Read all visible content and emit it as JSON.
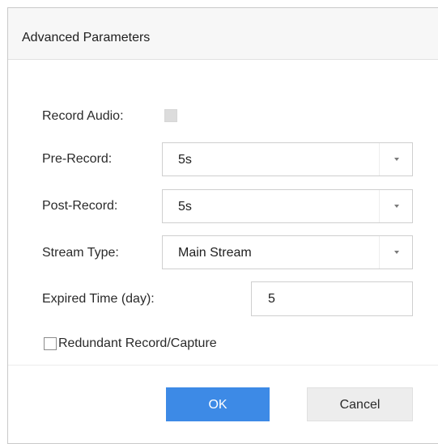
{
  "dialog": {
    "title": "Advanced Parameters"
  },
  "record_audio": {
    "label": "Record Audio:",
    "checked": false,
    "enabled": false
  },
  "pre_record": {
    "label": "Pre-Record:",
    "value": "5s"
  },
  "post_record": {
    "label": "Post-Record:",
    "value": "5s"
  },
  "stream_type": {
    "label": "Stream Type:",
    "value": "Main Stream"
  },
  "expired_time": {
    "label": "Expired Time (day):",
    "value": "5"
  },
  "redundant": {
    "label": "Redundant Record/Capture",
    "checked": false
  },
  "buttons": {
    "ok_label": "OK",
    "cancel_label": "Cancel"
  },
  "colors": {
    "primary_button": "#3d8ae6",
    "secondary_button": "#ededed",
    "header_background": "#f7f7f7"
  },
  "icons": {
    "dropdown": "chevron-down-icon"
  }
}
